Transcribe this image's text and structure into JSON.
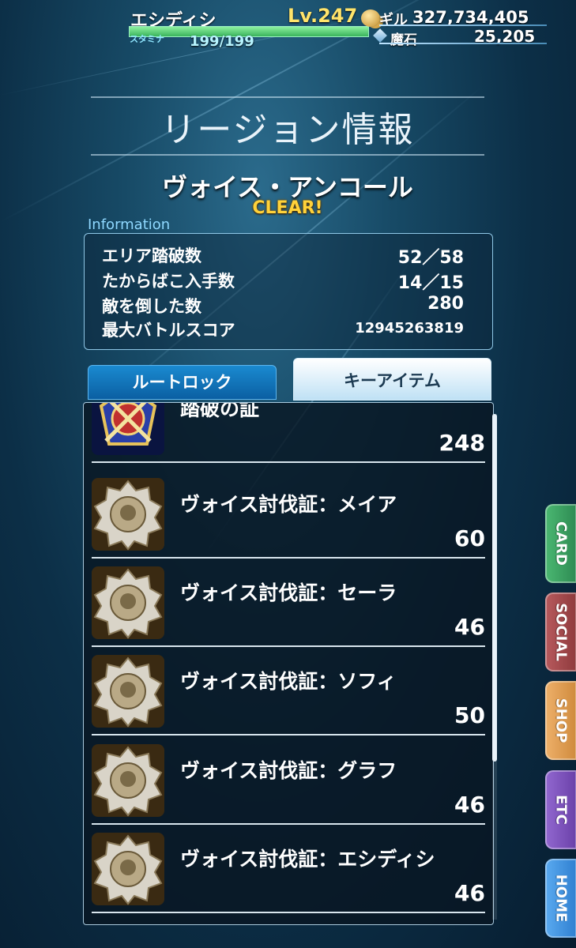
{
  "header": {
    "player_name": "エシディシ",
    "level": "Lv.247",
    "stamina_label": "スタミナ",
    "stamina": "199/199",
    "stamina_fraction": 1.0,
    "gil_label": "ギル",
    "gil": "327,734,405",
    "maseki_label": "魔石",
    "maseki": "25,205"
  },
  "page": {
    "title": "リージョン情報",
    "region_name": "ヴォイス・アンコール",
    "status": "CLEAR!"
  },
  "information": {
    "label": "Information",
    "rows": [
      {
        "key": "エリア踏破数",
        "value": "52／58"
      },
      {
        "key": "たからばこ入手数",
        "value": "14／15"
      },
      {
        "key": "敵を倒した数",
        "value": "280"
      },
      {
        "key": "最大バトルスコア",
        "value": "12945263819"
      }
    ]
  },
  "tabs": [
    {
      "label": "ルートロック",
      "active": false
    },
    {
      "label": "キーアイテム",
      "active": true
    }
  ],
  "key_items": [
    {
      "name": "踏破の証",
      "count": "248",
      "icon": "emblem-sword-icon"
    },
    {
      "name": "ヴォイス討伐証：メイア",
      "count": "60",
      "icon": "silver-medal-icon"
    },
    {
      "name": "ヴォイス討伐証：セーラ",
      "count": "46",
      "icon": "silver-medal-icon"
    },
    {
      "name": "ヴォイス討伐証：ソフィ",
      "count": "50",
      "icon": "silver-medal-icon"
    },
    {
      "name": "ヴォイス討伐証：グラフ",
      "count": "46",
      "icon": "silver-medal-icon"
    },
    {
      "name": "ヴォイス討伐証：エシディシ",
      "count": "46",
      "icon": "silver-medal-icon"
    }
  ],
  "side_nav": [
    {
      "label": "CARD",
      "color": "#3a9a5e"
    },
    {
      "label": "SOCIAL",
      "color": "#a3474a"
    },
    {
      "label": "SHOP",
      "color": "#d9974a"
    },
    {
      "label": "ETC",
      "color": "#7b4fb8"
    },
    {
      "label": "HOME",
      "color": "#3d8fd8"
    }
  ]
}
